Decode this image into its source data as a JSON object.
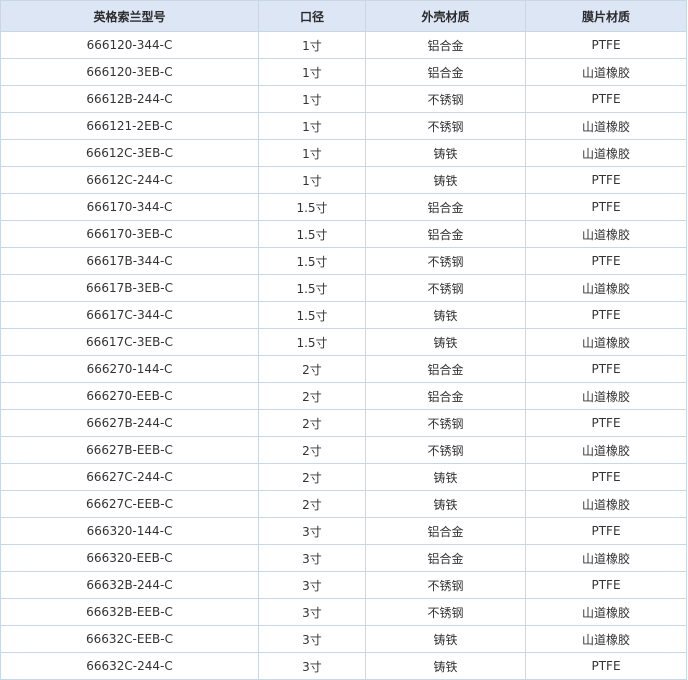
{
  "table": {
    "headers": [
      "英格索兰型号",
      "口径",
      "外壳材质",
      "膜片材质"
    ],
    "rows": [
      [
        "666120-344-C",
        "1寸",
        "铝合金",
        "PTFE"
      ],
      [
        "666120-3EB-C",
        "1寸",
        "铝合金",
        "山道橡胶"
      ],
      [
        "66612B-244-C",
        "1寸",
        "不锈钢",
        "PTFE"
      ],
      [
        "666121-2EB-C",
        "1寸",
        "不锈钢",
        "山道橡胶"
      ],
      [
        "66612C-3EB-C",
        "1寸",
        "铸铁",
        "山道橡胶"
      ],
      [
        "66612C-244-C",
        "1寸",
        "铸铁",
        "PTFE"
      ],
      [
        "666170-344-C",
        "1.5寸",
        "铝合金",
        "PTFE"
      ],
      [
        "666170-3EB-C",
        "1.5寸",
        "铝合金",
        "山道橡胶"
      ],
      [
        "66617B-344-C",
        "1.5寸",
        "不锈钢",
        "PTFE"
      ],
      [
        "66617B-3EB-C",
        "1.5寸",
        "不锈钢",
        "山道橡胶"
      ],
      [
        "66617C-344-C",
        "1.5寸",
        "铸铁",
        "PTFE"
      ],
      [
        "66617C-3EB-C",
        "1.5寸",
        "铸铁",
        "山道橡胶"
      ],
      [
        "666270-144-C",
        "2寸",
        "铝合金",
        "PTFE"
      ],
      [
        "666270-EEB-C",
        "2寸",
        "铝合金",
        "山道橡胶"
      ],
      [
        "66627B-244-C",
        "2寸",
        "不锈钢",
        "PTFE"
      ],
      [
        "66627B-EEB-C",
        "2寸",
        "不锈钢",
        "山道橡胶"
      ],
      [
        "66627C-244-C",
        "2寸",
        "铸铁",
        "PTFE"
      ],
      [
        "66627C-EEB-C",
        "2寸",
        "铸铁",
        "山道橡胶"
      ],
      [
        "666320-144-C",
        "3寸",
        "铝合金",
        "PTFE"
      ],
      [
        "666320-EEB-C",
        "3寸",
        "铝合金",
        "山道橡胶"
      ],
      [
        "66632B-244-C",
        "3寸",
        "不锈钢",
        "PTFE"
      ],
      [
        "66632B-EEB-C",
        "3寸",
        "不锈钢",
        "山道橡胶"
      ],
      [
        "66632C-EEB-C",
        "3寸",
        "铸铁",
        "山道橡胶"
      ],
      [
        "66632C-244-C",
        "3寸",
        "铸铁",
        "PTFE"
      ]
    ]
  },
  "colors": {
    "header_bg": "#dce6f4",
    "border": "#c9d6e6",
    "text": "#333333"
  }
}
